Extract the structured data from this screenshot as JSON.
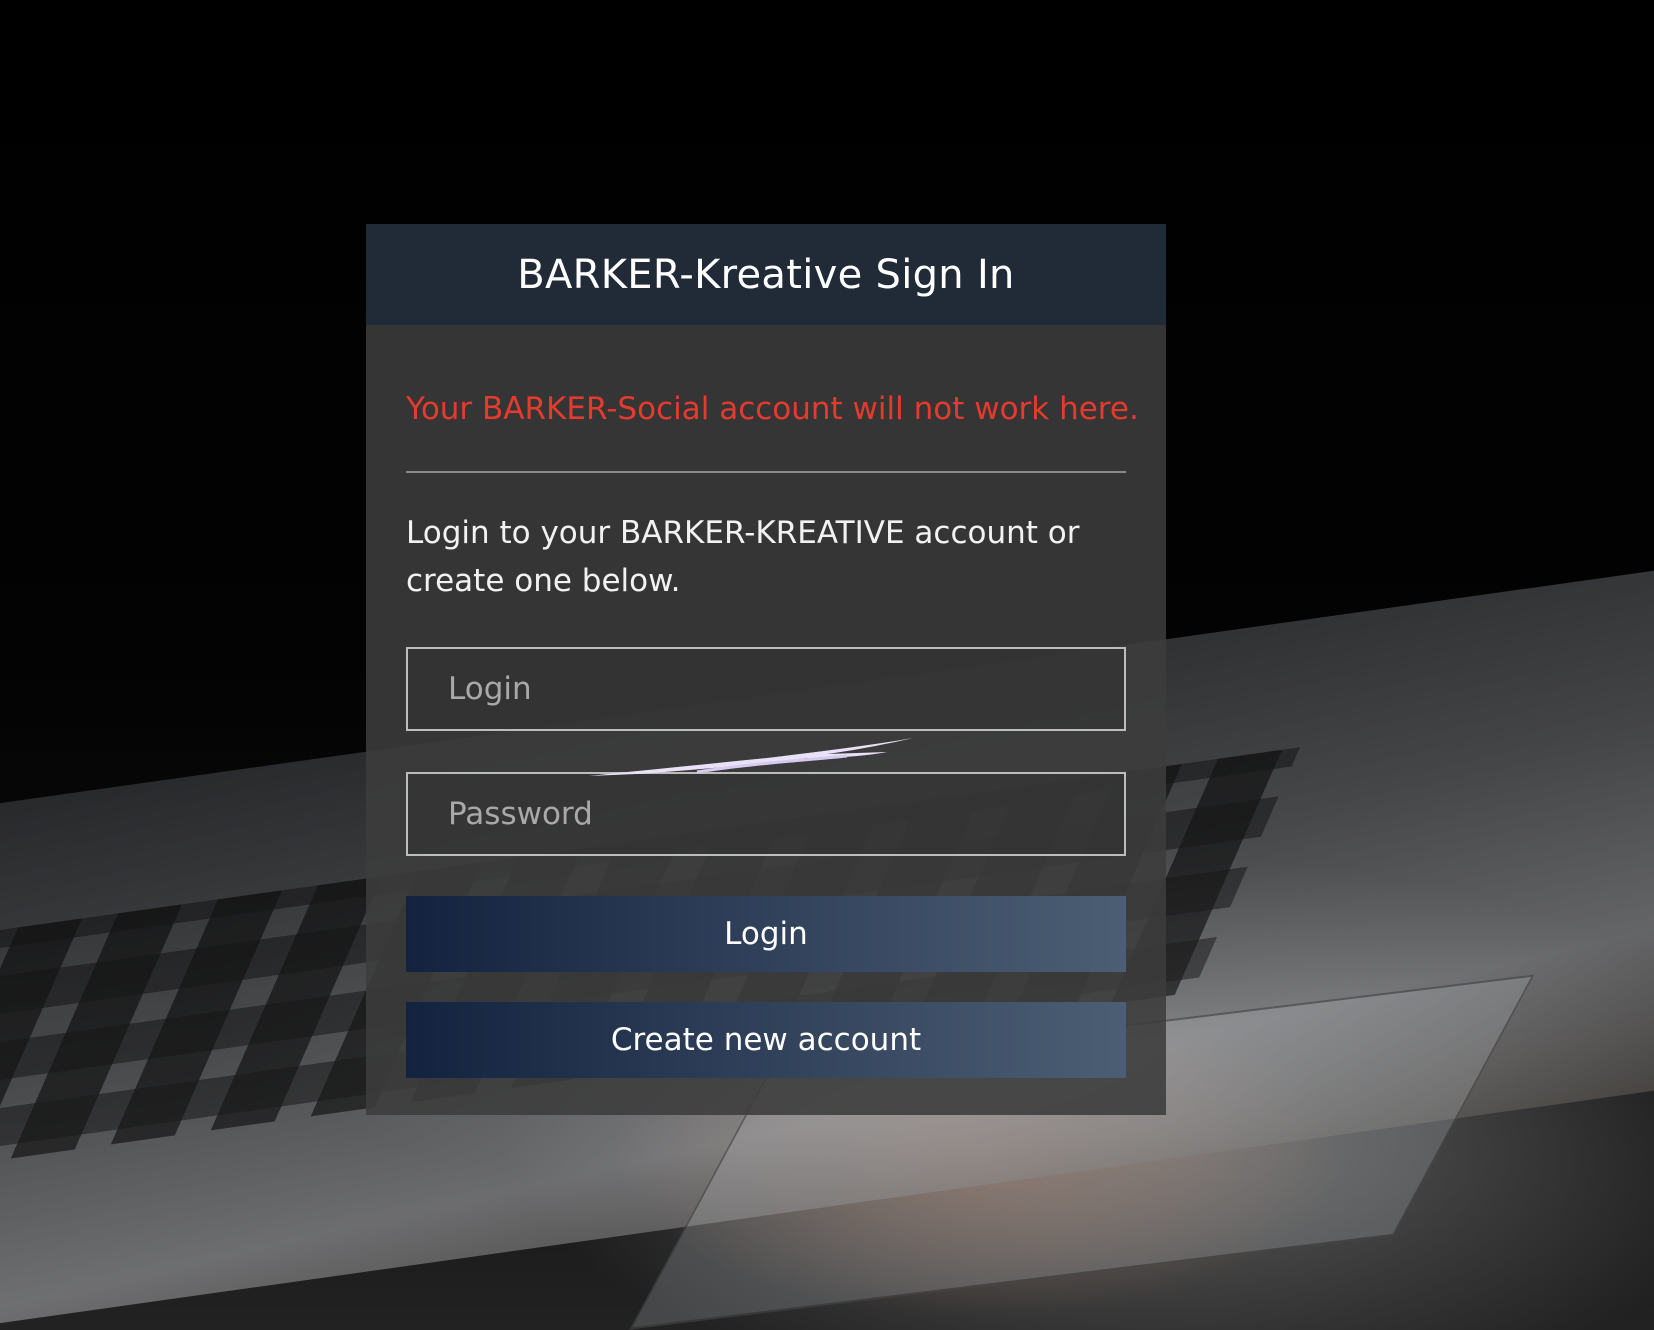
{
  "page": {
    "title": "BARKER-Kreative Sign In",
    "warning": "Your BARKER-Social account will not work here.",
    "intro": "Login to your BARKER-KREATIVE account or create one below."
  },
  "form": {
    "login_placeholder": "Login",
    "password_placeholder": "Password",
    "login_button": "Login",
    "create_button": "Create new account"
  },
  "colors": {
    "header": "#212b37",
    "warning": "#e53a2e",
    "button_gradient_start": "#13233f",
    "button_gradient_end": "#4c5e74"
  }
}
